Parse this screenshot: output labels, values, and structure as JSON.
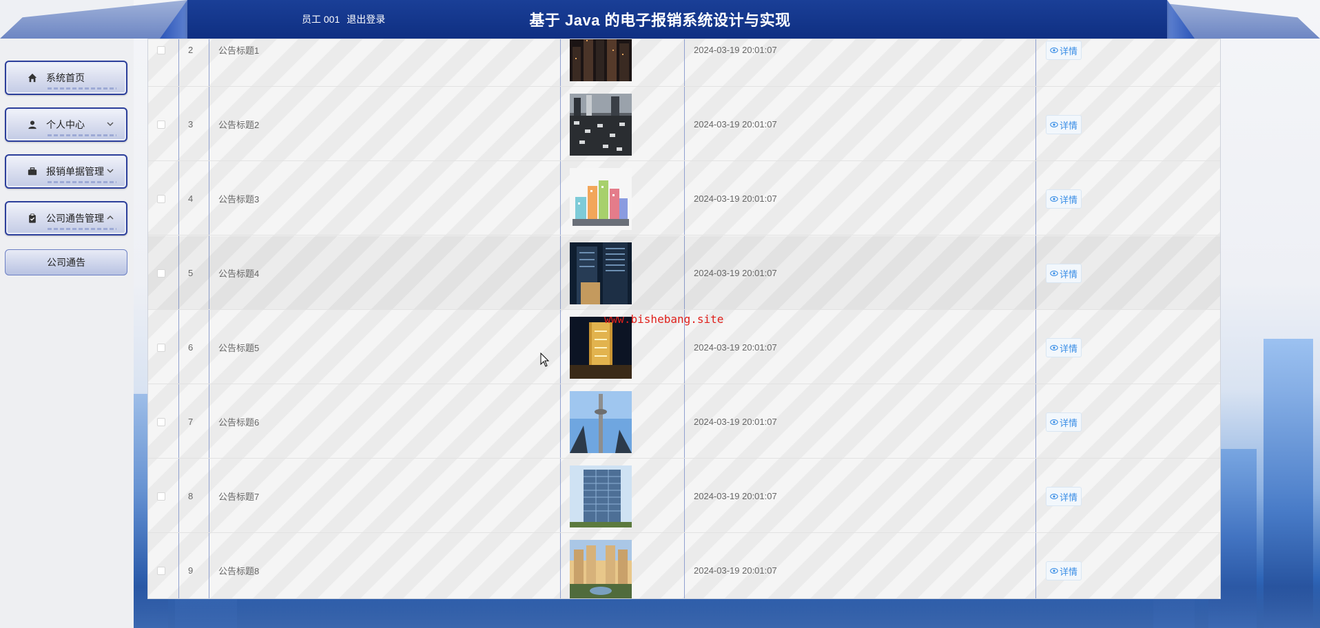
{
  "header": {
    "user_label": "员工 001",
    "logout_label": "退出登录",
    "title": "基于 Java 的电子报销系统设计与实现"
  },
  "sidebar": {
    "items": [
      {
        "label": "系统首页",
        "icon": "home-icon"
      },
      {
        "label": "个人中心",
        "icon": "user-icon"
      },
      {
        "label": "报销单据管理",
        "icon": "briefcase-icon"
      },
      {
        "label": "公司通告管理",
        "icon": "clipboard-icon"
      }
    ],
    "sub_item": "公司通告"
  },
  "table": {
    "detail_label": "详情",
    "rows": [
      {
        "index": "2",
        "title": "公告标题1",
        "date": "2024-03-19 20:01:07",
        "image": "city-skyline-night"
      },
      {
        "index": "3",
        "title": "公告标题2",
        "date": "2024-03-19 20:01:07",
        "image": "dense-city-street"
      },
      {
        "index": "4",
        "title": "公告标题3",
        "date": "2024-03-19 20:01:07",
        "image": "cartoon-city"
      },
      {
        "index": "5",
        "title": "公告标题4",
        "date": "2024-03-19 20:01:07",
        "image": "office-tower-night"
      },
      {
        "index": "6",
        "title": "公告标题5",
        "date": "2024-03-19 20:01:07",
        "image": "golden-tower"
      },
      {
        "index": "7",
        "title": "公告标题6",
        "date": "2024-03-19 20:01:07",
        "image": "cn-tower"
      },
      {
        "index": "8",
        "title": "公告标题7",
        "date": "2024-03-19 20:01:07",
        "image": "glass-office"
      },
      {
        "index": "9",
        "title": "公告标题8",
        "date": "2024-03-19 20:01:07",
        "image": "residential-complex"
      }
    ]
  },
  "watermark": "www.bishebang.site"
}
